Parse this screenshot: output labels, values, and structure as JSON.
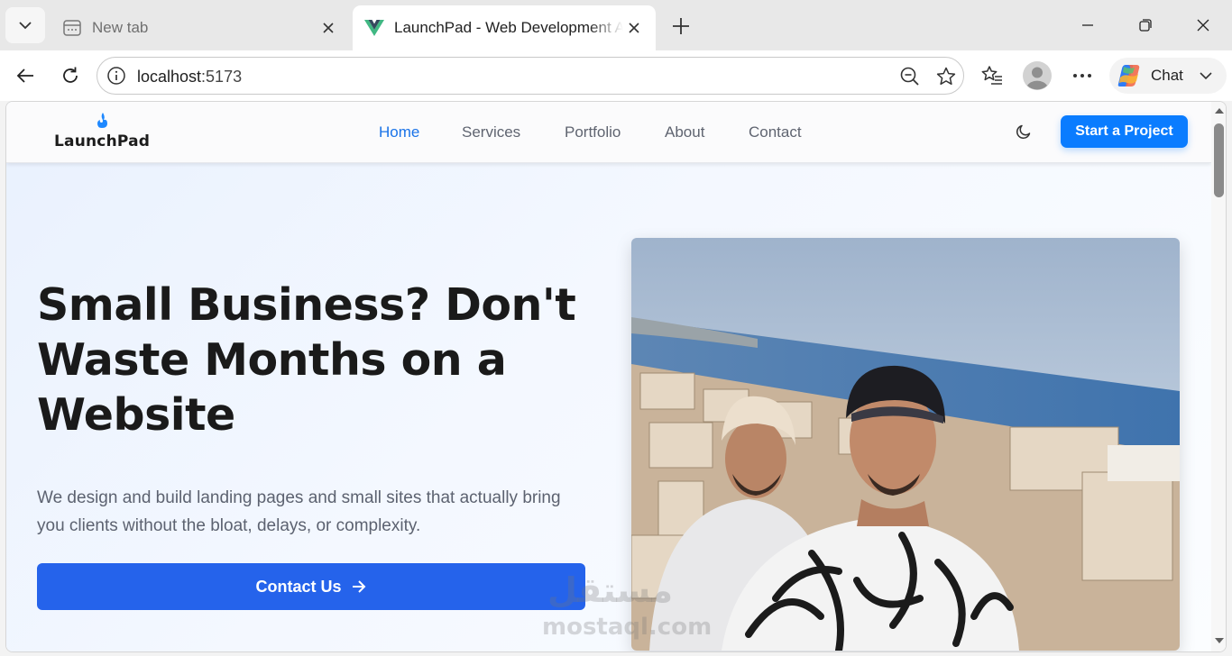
{
  "browser": {
    "tabs": [
      {
        "title": "New tab",
        "icon": "new-tab-page-icon",
        "active": false
      },
      {
        "title": "LaunchPad - Web Development Agency",
        "icon": "vue-logo-icon",
        "active": true
      }
    ],
    "address": {
      "host": "localhost",
      "port": ":5173"
    },
    "copilot_label": "Chat"
  },
  "site": {
    "logo_text": "LaunchPad",
    "nav": [
      {
        "label": "Home",
        "active": true
      },
      {
        "label": "Services",
        "active": false
      },
      {
        "label": "Portfolio",
        "active": false
      },
      {
        "label": "About",
        "active": false
      },
      {
        "label": "Contact",
        "active": false
      }
    ],
    "cta_label": "Start a Project",
    "hero": {
      "title": "Small Business? Don't Waste Months on a Website",
      "subtitle": "We design and build landing pages and small sites that actually bring you clients without the bloat, delays, or complexity.",
      "button_label": "Contact Us"
    },
    "watermark": {
      "arabic": "مستقل",
      "latin": "mostaql.com"
    }
  },
  "colors": {
    "accent": "#0a7cff",
    "hero_button": "#2563eb",
    "nav_active": "#1a73e8"
  }
}
